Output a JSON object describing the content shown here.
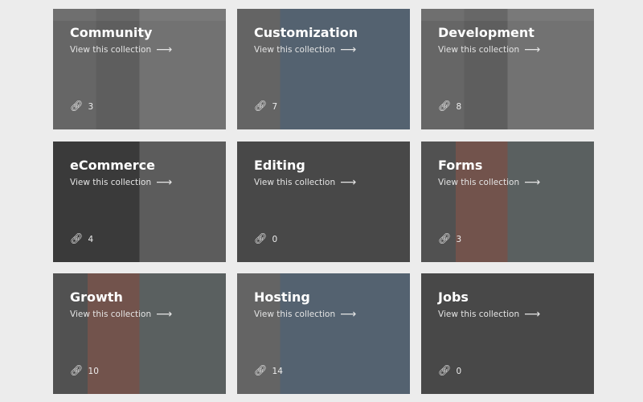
{
  "link_text": "View this collection",
  "collections": [
    {
      "title": "Community",
      "count": "3"
    },
    {
      "title": "Customization",
      "count": "7"
    },
    {
      "title": "Development",
      "count": "8"
    },
    {
      "title": "eCommerce",
      "count": "4"
    },
    {
      "title": "Editing",
      "count": "0"
    },
    {
      "title": "Forms",
      "count": "3"
    },
    {
      "title": "Growth",
      "count": "10"
    },
    {
      "title": "Hosting",
      "count": "14"
    },
    {
      "title": "Jobs",
      "count": "0"
    }
  ]
}
